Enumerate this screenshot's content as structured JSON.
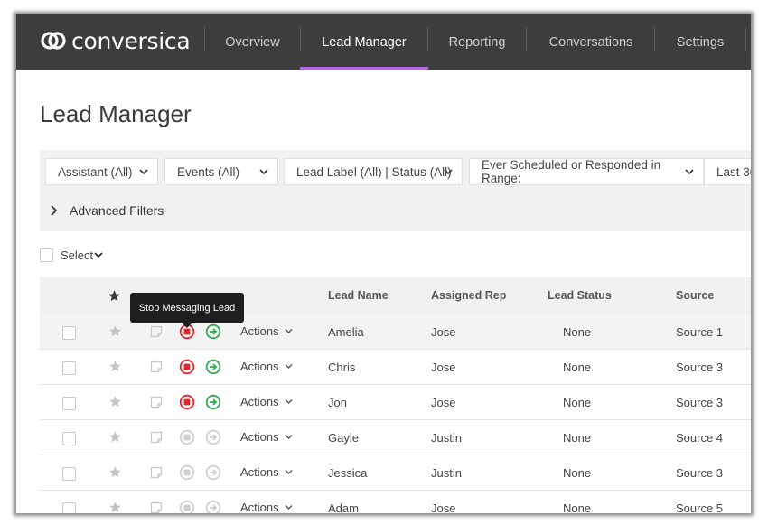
{
  "app": {
    "logo_text": "conversica"
  },
  "nav": {
    "items": [
      {
        "label": "Overview"
      },
      {
        "label": "Lead Manager"
      },
      {
        "label": "Reporting"
      },
      {
        "label": "Conversations"
      },
      {
        "label": "Settings"
      }
    ],
    "active": "Lead Manager"
  },
  "page": {
    "title": "Lead Manager"
  },
  "filters": {
    "assistant": "Assistant (All)",
    "events": "Events (All)",
    "lead_label_status": "Lead Label (All) | Status (All)",
    "range": "Ever Scheduled or Responded in Range:",
    "period": "Last 30"
  },
  "advanced_filters": "Advanced Filters",
  "select_label": "Select",
  "tooltip": "Stop Messaging Lead",
  "table": {
    "headers": {
      "lead_name": "Lead Name",
      "assigned_rep": "Assigned Rep",
      "lead_status": "Lead Status",
      "source": "Source"
    },
    "actions_label": "Actions",
    "rows": [
      {
        "name": "Amelia",
        "rep": "Jose",
        "status": "None",
        "source": "Source 1",
        "enabled": true
      },
      {
        "name": "Chris",
        "rep": "Jose",
        "status": "None",
        "source": "Source 3",
        "enabled": true
      },
      {
        "name": "Jon",
        "rep": "Jose",
        "status": "None",
        "source": "Source 3",
        "enabled": true
      },
      {
        "name": "Gayle",
        "rep": "Justin",
        "status": "None",
        "source": "Source 4",
        "enabled": false
      },
      {
        "name": "Jessica",
        "rep": "Justin",
        "status": "None",
        "source": "Source 3",
        "enabled": false
      },
      {
        "name": "Adam",
        "rep": "Jose",
        "status": "None",
        "source": "Source 5",
        "enabled": false
      }
    ]
  },
  "colors": {
    "nav_bg": "#3d3d3d",
    "accent": "#b46ae8",
    "stop_red": "#e0252b",
    "go_green": "#34a853",
    "disabled": "#cfcfcf"
  }
}
